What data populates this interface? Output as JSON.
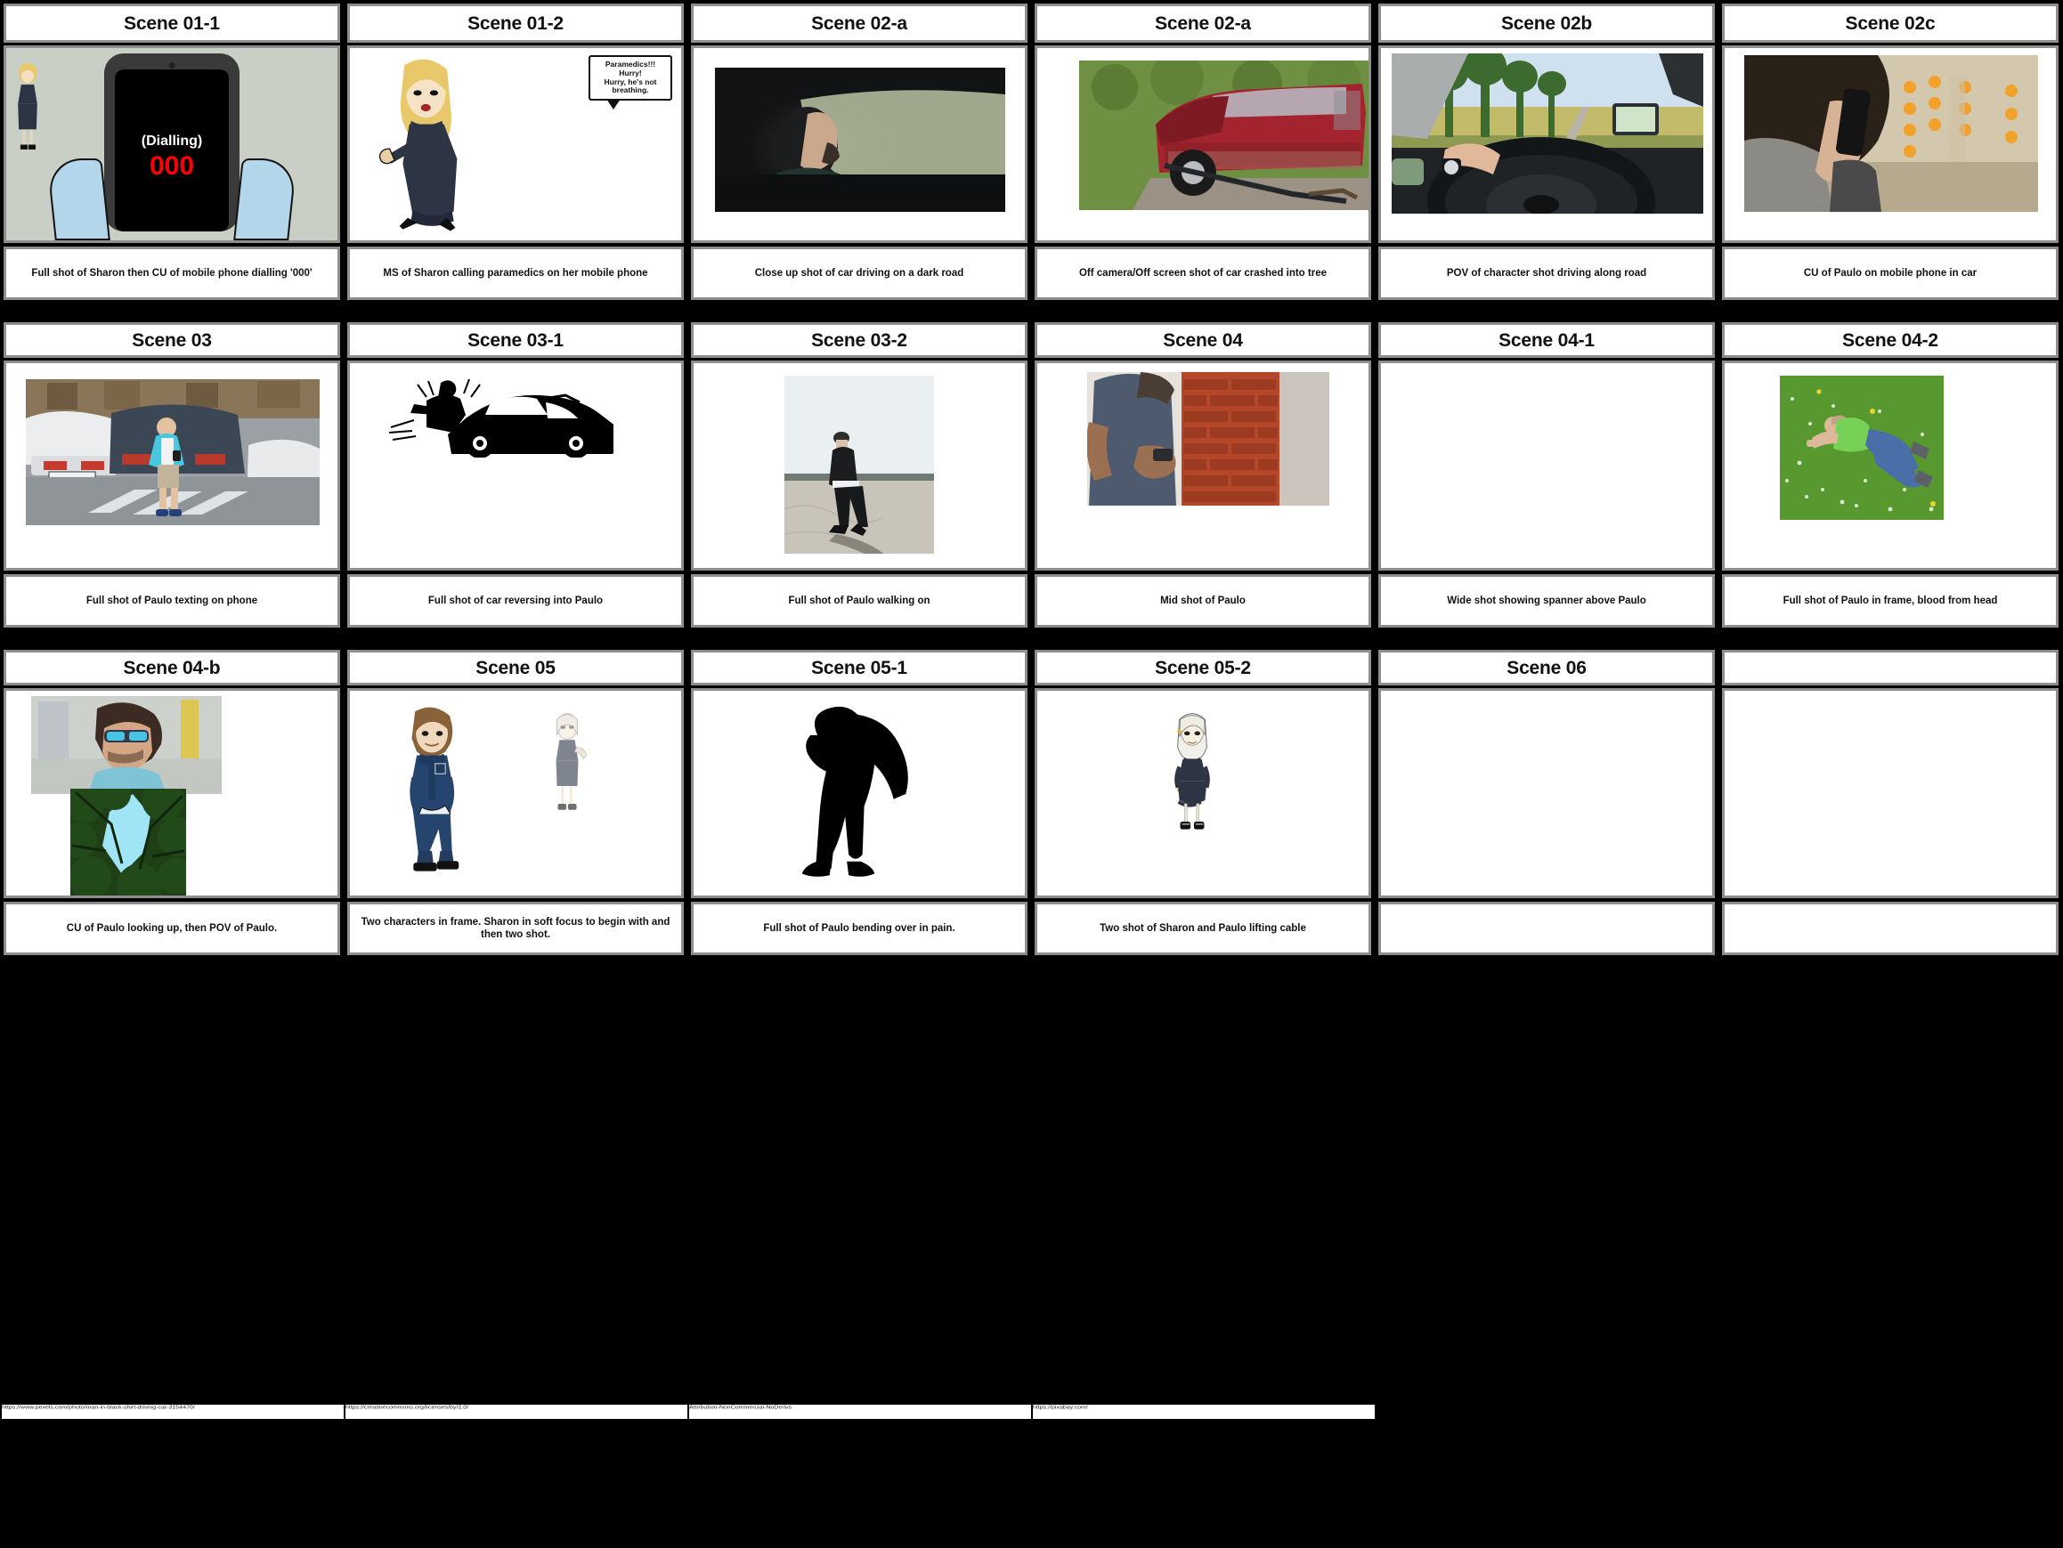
{
  "document": {
    "type": "storyboard",
    "columns": 6,
    "rows": 3,
    "frame_border_color": "#8e8e8e",
    "background_color": "#000000",
    "panel_fill": "#ffffff"
  },
  "rows": [
    {
      "cells": [
        {
          "title": "Scene 01-1",
          "caption": "Full shot of Sharon then CU of mobile phone dialling '000'",
          "art": "sharon-dialling-phone",
          "art_labels": {
            "dialling": "(Dialling)",
            "number": "000"
          },
          "has_art": true
        },
        {
          "title": "Scene 01-2",
          "caption": "MS of Sharon calling paramedics on her mobile phone",
          "art": "sharon-kneeling-speech",
          "art_labels": {
            "speech": "Paramedics!!!\nHurry!\nHurry, he's not breathing."
          },
          "has_art": true
        },
        {
          "title": "Scene 02-a",
          "caption": "Close up shot of car driving on a dark road",
          "art": "man-driving-dark-road",
          "has_art": true
        },
        {
          "title": "Scene 02-a",
          "caption": "Off camera/Off screen shot of car crashed into tree",
          "art": "red-car-crashed",
          "has_art": true
        },
        {
          "title": "Scene 02b",
          "caption": "POV of character shot driving along road",
          "art": "pov-steering-wheel-road",
          "has_art": true
        },
        {
          "title": "Scene 02c",
          "caption": "CU of Paulo on mobile phone in car",
          "art": "man-on-mobile-phone",
          "has_art": true
        }
      ]
    },
    {
      "cells": [
        {
          "title": "Scene 03",
          "caption": "Full shot of Paulo texting on phone",
          "art": "man-texting-crosswalk",
          "has_art": true
        },
        {
          "title": "Scene 03-1",
          "caption": "Full shot of car reversing into Paulo",
          "art": "car-hitting-person-silhouette",
          "has_art": true
        },
        {
          "title": "Scene 03-2",
          "caption": "Full shot of Paulo walking on",
          "art": "man-walking-pavement",
          "has_art": true
        },
        {
          "title": "Scene 04",
          "caption": "Mid shot of Paulo",
          "art": "man-phone-brick-wall",
          "has_art": true
        },
        {
          "title": "Scene 04-1",
          "caption": "Wide shot showing spanner above Paulo",
          "art": "",
          "has_art": false
        },
        {
          "title": "Scene 04-2",
          "caption": "Full shot of Paulo in frame, blood from head",
          "art": "man-lying-on-grass",
          "has_art": true
        }
      ]
    },
    {
      "cells": [
        {
          "title": "Scene 04-b",
          "caption": "CU of Paulo looking up, then POV of Paulo.",
          "art": "man-looking-up-and-treetops",
          "has_art": true
        },
        {
          "title": "Scene 05",
          "caption": "Two characters in frame. Sharon in soft focus to begin with and then two shot.",
          "art": "paramedic-and-sharon",
          "has_art": true
        },
        {
          "title": "Scene 05-1",
          "caption": "Full shot of Paulo bending over in pain.",
          "art": "person-bending-silhouette",
          "has_art": true
        },
        {
          "title": "Scene 05-2",
          "caption": "Two shot of Sharon and Paulo lifting cable",
          "art": "sharon-standing",
          "has_art": true
        },
        {
          "title": "Scene 06",
          "caption": "",
          "art": "",
          "has_art": false
        },
        {
          "title": "",
          "caption": "",
          "art": "",
          "has_art": false
        }
      ]
    }
  ],
  "footer": {
    "attributions": [
      "https://www.pexels.com/photo/man-in-black-shirt-driving-car-3154470/",
      "https://creativecommons.org/licenses/by/2.0/",
      "Attribution-NonCommercial-NoDerivs",
      "https://pixabay.com/"
    ]
  }
}
